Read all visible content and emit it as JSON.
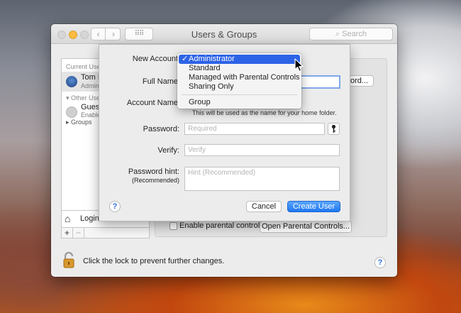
{
  "window": {
    "title": "Users & Groups",
    "search_placeholder": "Search"
  },
  "sidebar": {
    "current_users_header": "Current Use",
    "current_user_name": "Tom M",
    "current_user_role": "Admin",
    "other_users_header": "Other Use",
    "guest_name": "Gues",
    "guest_status": "Enable",
    "groups_label": "Groups",
    "login_options_label": "Login",
    "add_label": "+",
    "remove_label": "−"
  },
  "panel": {
    "password_button": "ord...",
    "parental_checkbox_label": "Enable parental controls",
    "parental_button": "Open Parental Controls..."
  },
  "footer": {
    "lock_text": "Click the lock to prevent further changes.",
    "help": "?"
  },
  "sheet": {
    "new_account_label": "New Account",
    "full_name_label": "Full Name",
    "account_name_label": "Account Name",
    "account_name_hint": "This will be used as the name for your home folder.",
    "password_label": "Password:",
    "password_placeholder": "Required",
    "verify_label": "Verify:",
    "verify_placeholder": "Verify",
    "password_hint_label": "Password hint:",
    "password_hint_sublabel": "(Recommended)",
    "password_hint_placeholder": "Hint (Recommended)",
    "help": "?",
    "cancel_button": "Cancel",
    "create_button": "Create User"
  },
  "account_type_menu": {
    "selected": "Administrator",
    "checkmark": "✓",
    "items": [
      "Administrator",
      "Standard",
      "Managed with Parental Controls",
      "Sharing Only",
      "Group"
    ]
  },
  "colors": {
    "accent": "#2d63e6",
    "button_blue": "#1f78f0"
  }
}
